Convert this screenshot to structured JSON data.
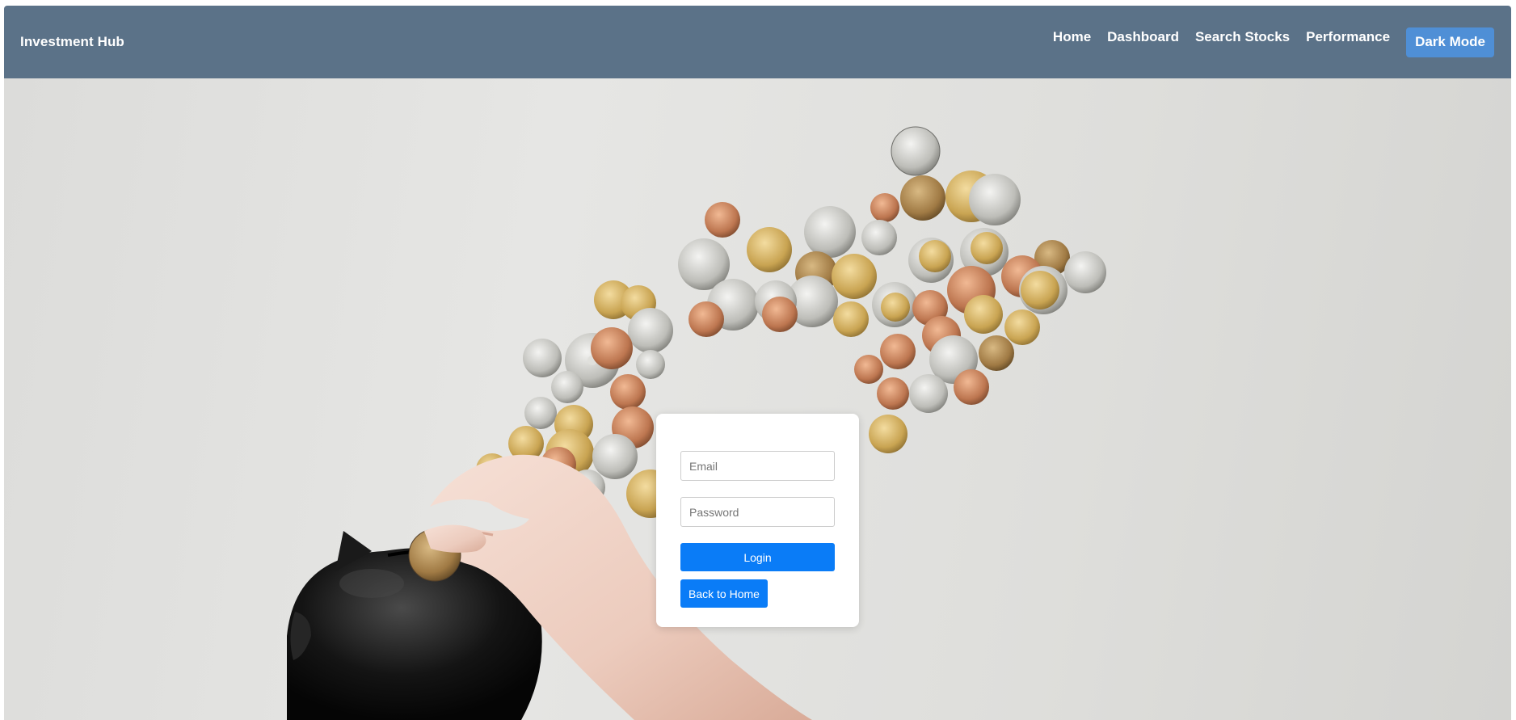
{
  "navbar": {
    "brand": "Investment Hub",
    "links": [
      "Home",
      "Dashboard",
      "Search Stocks",
      "Performance"
    ],
    "dark_mode_label": "Dark Mode"
  },
  "login_form": {
    "email_placeholder": "Email",
    "password_placeholder": "Password",
    "login_label": "Login",
    "back_label": "Back to Home"
  },
  "colors": {
    "navbar_bg": "#5b7288",
    "dark_mode_button": "#4f8fd6",
    "primary_button": "#0a7cf7",
    "card_bg": "#ffffff"
  },
  "background": {
    "image": "hand dropping coin into black piggy bank with scattered coins"
  }
}
